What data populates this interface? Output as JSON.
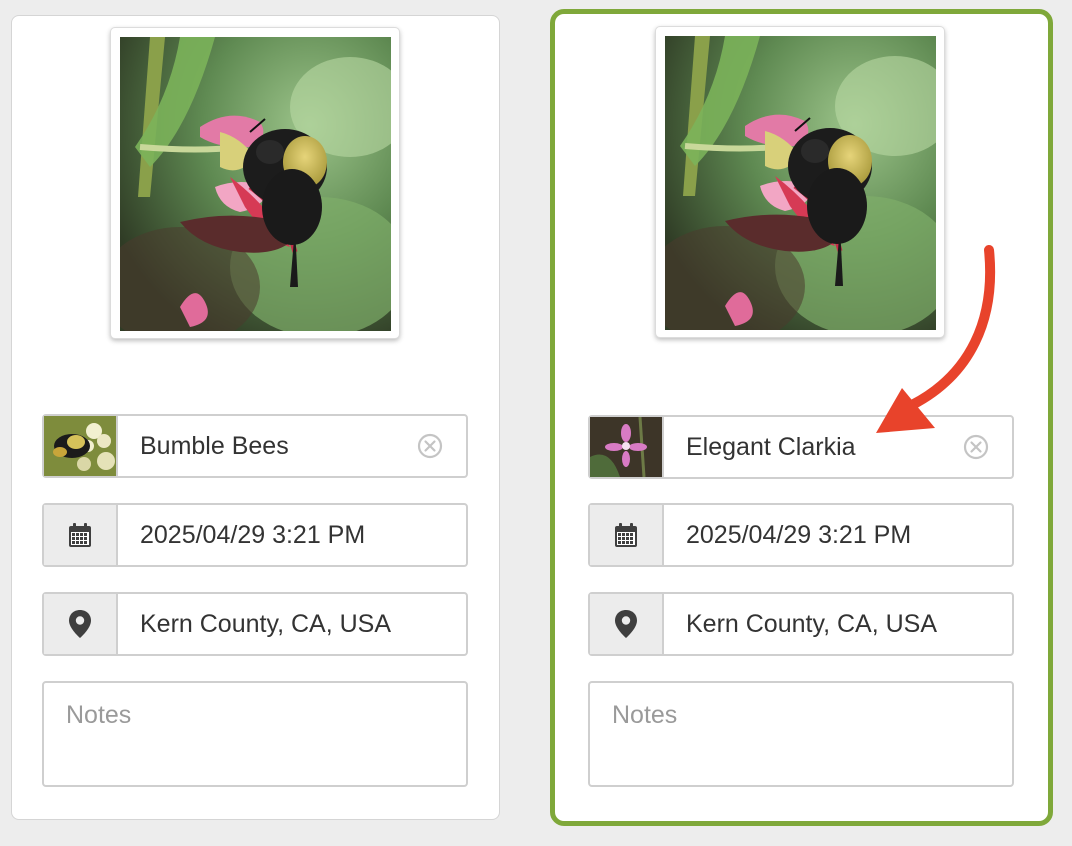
{
  "cards": [
    {
      "selected": false,
      "taxon": {
        "name": "Bumble Bees",
        "thumbnail_icon": "bumble-bee-thumbnail"
      },
      "datetime": {
        "value": "2025/04/29 3:21 PM",
        "icon": "calendar-icon"
      },
      "location": {
        "value": "Kern County, CA, USA",
        "icon": "map-pin-icon"
      },
      "notes": {
        "placeholder": "Notes",
        "value": ""
      }
    },
    {
      "selected": true,
      "taxon": {
        "name": "Elegant Clarkia",
        "thumbnail_icon": "clarkia-flower-thumbnail"
      },
      "datetime": {
        "value": "2025/04/29 3:21 PM",
        "icon": "calendar-icon"
      },
      "location": {
        "value": "Kern County, CA, USA",
        "icon": "map-pin-icon"
      },
      "notes": {
        "placeholder": "Notes",
        "value": ""
      }
    }
  ],
  "colors": {
    "selected_border": "#7fa83a",
    "annotation_arrow": "#e8432b"
  }
}
